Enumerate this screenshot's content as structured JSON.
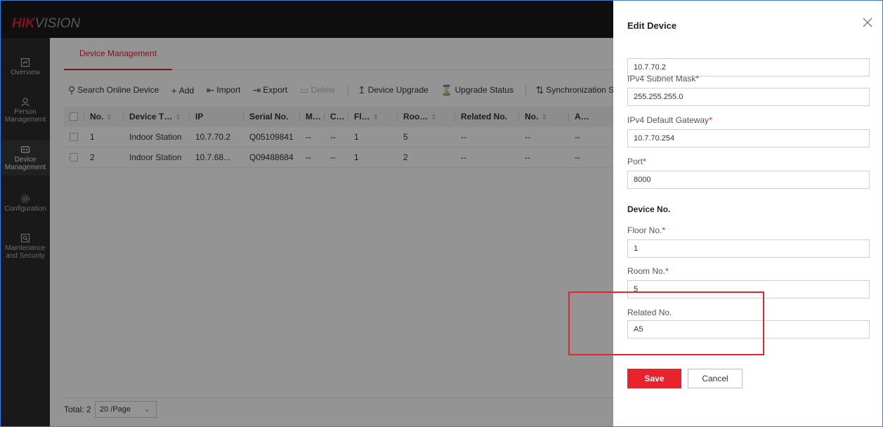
{
  "brand": {
    "hik": "HIK",
    "vision": "VISION"
  },
  "sidebar": {
    "items": [
      {
        "label": "Overview",
        "icon": "dashboard-icon"
      },
      {
        "label": "Person Management",
        "icon": "person-icon"
      },
      {
        "label": "Device Management",
        "icon": "device-icon",
        "active": true
      },
      {
        "label": "Configuration",
        "icon": "gear-icon"
      },
      {
        "label": "Maintenance and Security",
        "icon": "shield-icon"
      }
    ]
  },
  "main": {
    "tab": "Device Management",
    "toolbar": {
      "search": "Search Online Device",
      "add": "Add",
      "import": "Import",
      "export": "Export",
      "delete": "Delete",
      "upgrade": "Device Upgrade",
      "upgrade_status": "Upgrade Status",
      "sync": "Synchronization Setting"
    },
    "table": {
      "columns": [
        "No.",
        "Device T…",
        "IP",
        "Serial No.",
        "M…",
        "C…",
        "Fl…",
        "Roo…",
        "Related No.",
        "No.",
        "A…"
      ],
      "rows": [
        [
          "1",
          "Indoor Station",
          "10.7.70.2",
          "Q05109841",
          "--",
          "--",
          "1",
          "5",
          "--",
          "--",
          "--"
        ],
        [
          "2",
          "Indoor Station",
          "10.7.68...",
          "Q09488684",
          "--",
          "--",
          "1",
          "2",
          "--",
          "--",
          "--"
        ]
      ]
    },
    "footer": {
      "total": "Total: 2",
      "page_size": "20 /Page"
    }
  },
  "drawer": {
    "title": "Edit Device",
    "ip_value": "10.7.70.2",
    "subnet_label": "IPv4 Subnet Mask",
    "subnet_value": "255.255.255.0",
    "gateway_label": "IPv4 Default Gateway",
    "gateway_value": "10.7.70.254",
    "port_label": "Port",
    "port_value": "8000",
    "device_no_section": "Device No.",
    "floor_label": "Floor No.",
    "floor_value": "1",
    "room_label": "Room No.",
    "room_value": "5",
    "related_label": "Related No.",
    "related_value": "A5",
    "save": "Save",
    "cancel": "Cancel",
    "required_mark": "*"
  },
  "colors": {
    "accent": "#e8232e",
    "sidebar": "#2b2b2b",
    "topbar": "#1a1a1a"
  }
}
